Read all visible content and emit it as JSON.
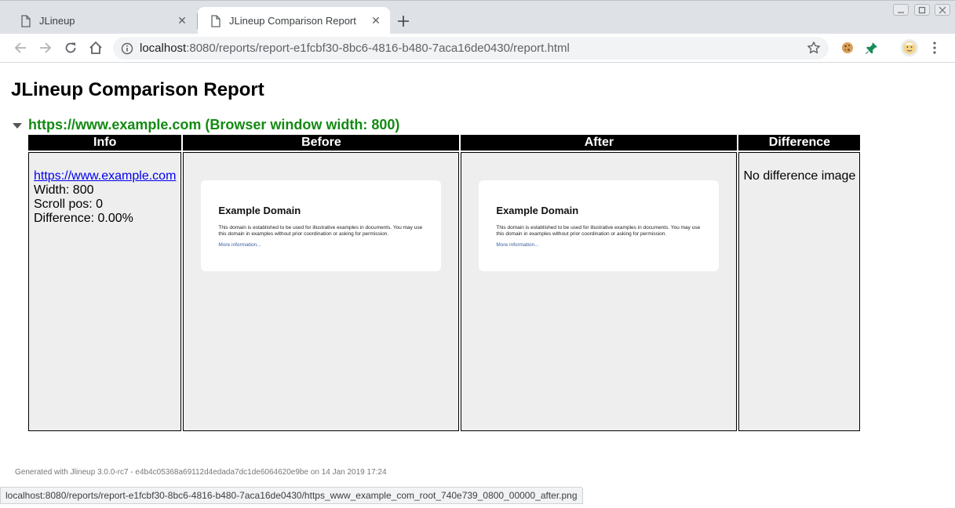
{
  "browser": {
    "tabs": [
      {
        "title": "JLineup",
        "active": false
      },
      {
        "title": "JLineup Comparison Report",
        "active": true
      }
    ],
    "address": {
      "host": "localhost",
      "path": ":8080/reports/report-e1fcbf30-8bc6-4816-b480-7aca16de0430/report.html"
    },
    "status_url": "localhost:8080/reports/report-e1fcbf30-8bc6-4816-b480-7aca16de0430/https_www_example_com_root_740e739_0800_00000_after.png",
    "icons": {
      "back": "back-arrow-icon",
      "forward": "forward-arrow-icon",
      "reload": "reload-icon",
      "home": "home-icon",
      "info": "info-icon",
      "bookmark": "star-icon",
      "extension1": "cookie-icon",
      "extension2": "pin-icon",
      "profile": "profile-avatar-icon",
      "menu": "kebab-menu-icon"
    }
  },
  "page": {
    "title": "JLineup Comparison Report",
    "section": {
      "summary": "https://www.example.com (Browser window width: 800)"
    },
    "table": {
      "headers": [
        "Info",
        "Before",
        "After",
        "Difference"
      ],
      "info": {
        "link": "https://www.example.com",
        "width": "Width: 800",
        "scroll": "Scroll pos: 0",
        "difference": "Difference: 0.00%"
      },
      "screenshot": {
        "heading": "Example Domain",
        "body": "This domain is established to be used for illustrative examples in documents. You may use this domain in examples without prior coordination or asking for permission.",
        "link": "More information..."
      },
      "difference_text": "No difference image"
    },
    "footer": "Generated with Jlineup 3.0.0-rc7 - e4b4c05368a69112d4edada7dc1de6064620e9be on 14 Jan 2019 17:24"
  },
  "colors": {
    "summary_green": "#138a12",
    "link_blue": "#0000ee",
    "cell_bg": "#eeeeef"
  }
}
